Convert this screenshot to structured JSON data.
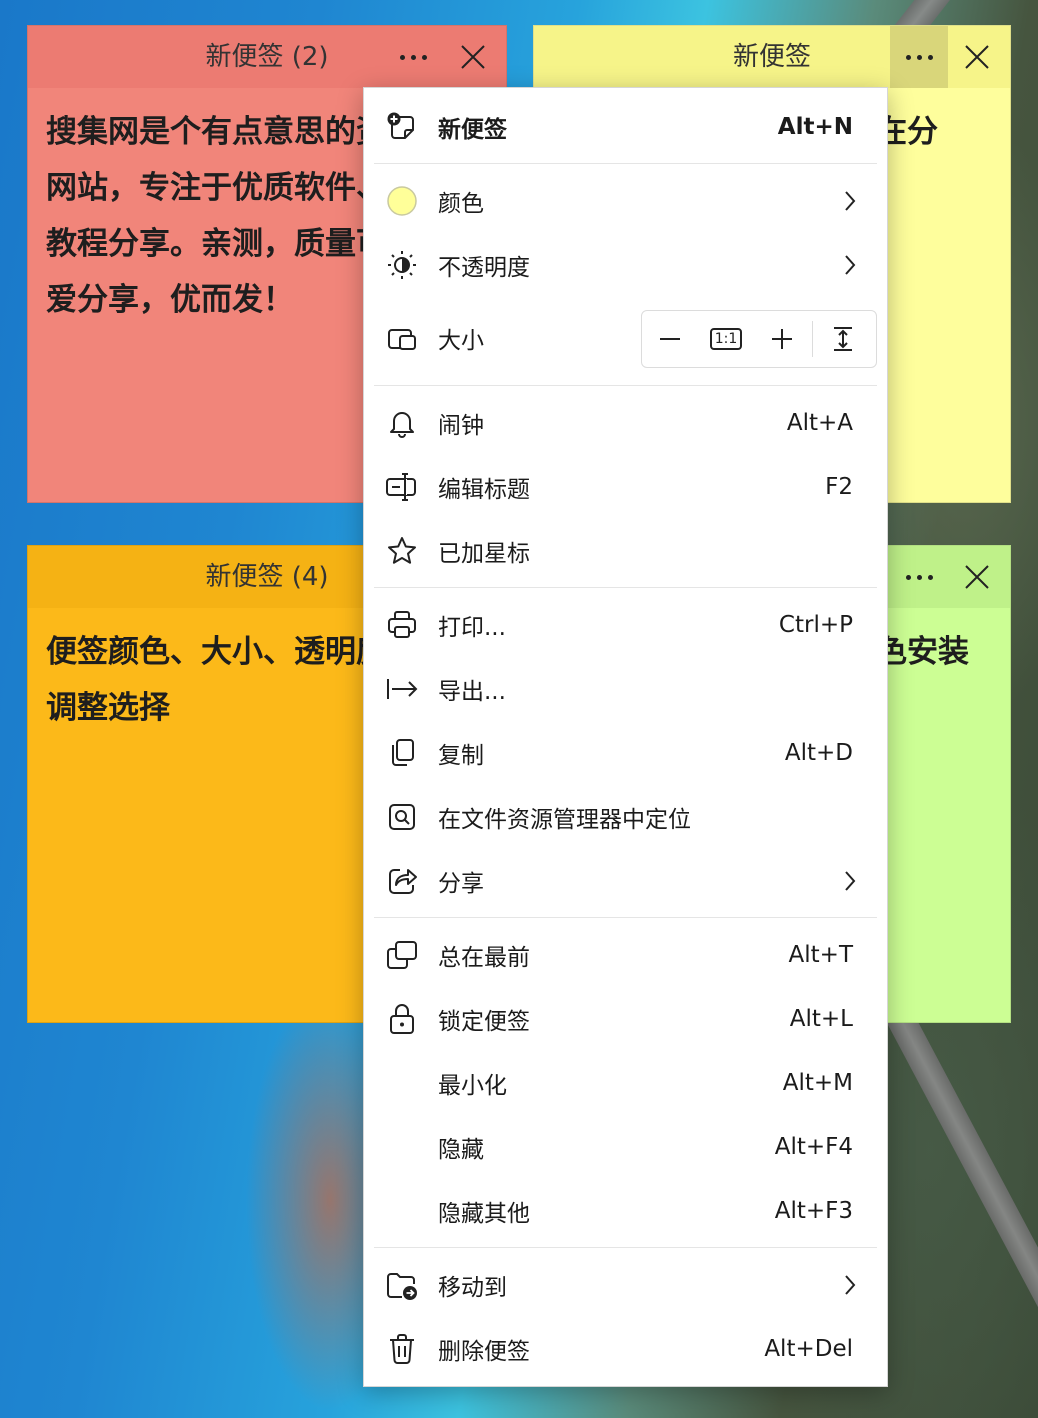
{
  "notes": {
    "red": {
      "title": "新便签 (2)",
      "body": "搜集网是个有点意思的资源分享网站，专注于优质软件、资源、教程分享。亲测，质量可靠，热爱分享，优而发！",
      "color": "#f1857a"
    },
    "yellow": {
      "title": "新便签",
      "body": "在分",
      "color": "#fefe9c"
    },
    "orange": {
      "title": "新便签 (4)",
      "body": "便签颜色、大小、透明度可随意调整选择",
      "color": "#fcb919"
    },
    "green": {
      "title": "",
      "body": "色安装",
      "color": "#ccfe94"
    }
  },
  "menu": {
    "new_note": {
      "label": "新便签",
      "shortcut": "Alt+N",
      "icon": "new-note-icon"
    },
    "color": {
      "label": "颜色",
      "icon": "color-swatch-icon",
      "swatch": "#ffff99"
    },
    "opacity": {
      "label": "不透明度",
      "icon": "brightness-icon"
    },
    "size": {
      "label": "大小",
      "icon": "resize-icon",
      "ratio_label": "1:1"
    },
    "alarm": {
      "label": "闹钟",
      "shortcut": "Alt+A",
      "icon": "bell-icon"
    },
    "edit_title": {
      "label": "编辑标题",
      "shortcut": "F2",
      "icon": "edit-title-icon"
    },
    "starred": {
      "label": "已加星标",
      "icon": "star-icon"
    },
    "print": {
      "label": "打印...",
      "shortcut": "Ctrl+P",
      "icon": "printer-icon"
    },
    "export": {
      "label": "导出...",
      "icon": "export-icon"
    },
    "copy": {
      "label": "复制",
      "shortcut": "Alt+D",
      "icon": "copy-icon"
    },
    "locate": {
      "label": "在文件资源管理器中定位",
      "icon": "locate-file-icon"
    },
    "share": {
      "label": "分享",
      "icon": "share-icon"
    },
    "always_on_top": {
      "label": "总在最前",
      "shortcut": "Alt+T",
      "icon": "window-stack-icon"
    },
    "lock": {
      "label": "锁定便签",
      "shortcut": "Alt+L",
      "icon": "lock-icon"
    },
    "minimize": {
      "label": "最小化",
      "shortcut": "Alt+M"
    },
    "hide": {
      "label": "隐藏",
      "shortcut": "Alt+F4"
    },
    "hide_others": {
      "label": "隐藏其他",
      "shortcut": "Alt+F3"
    },
    "move_to": {
      "label": "移动到",
      "icon": "folder-move-icon"
    },
    "delete": {
      "label": "删除便签",
      "shortcut": "Alt+Del",
      "icon": "trash-icon"
    }
  }
}
